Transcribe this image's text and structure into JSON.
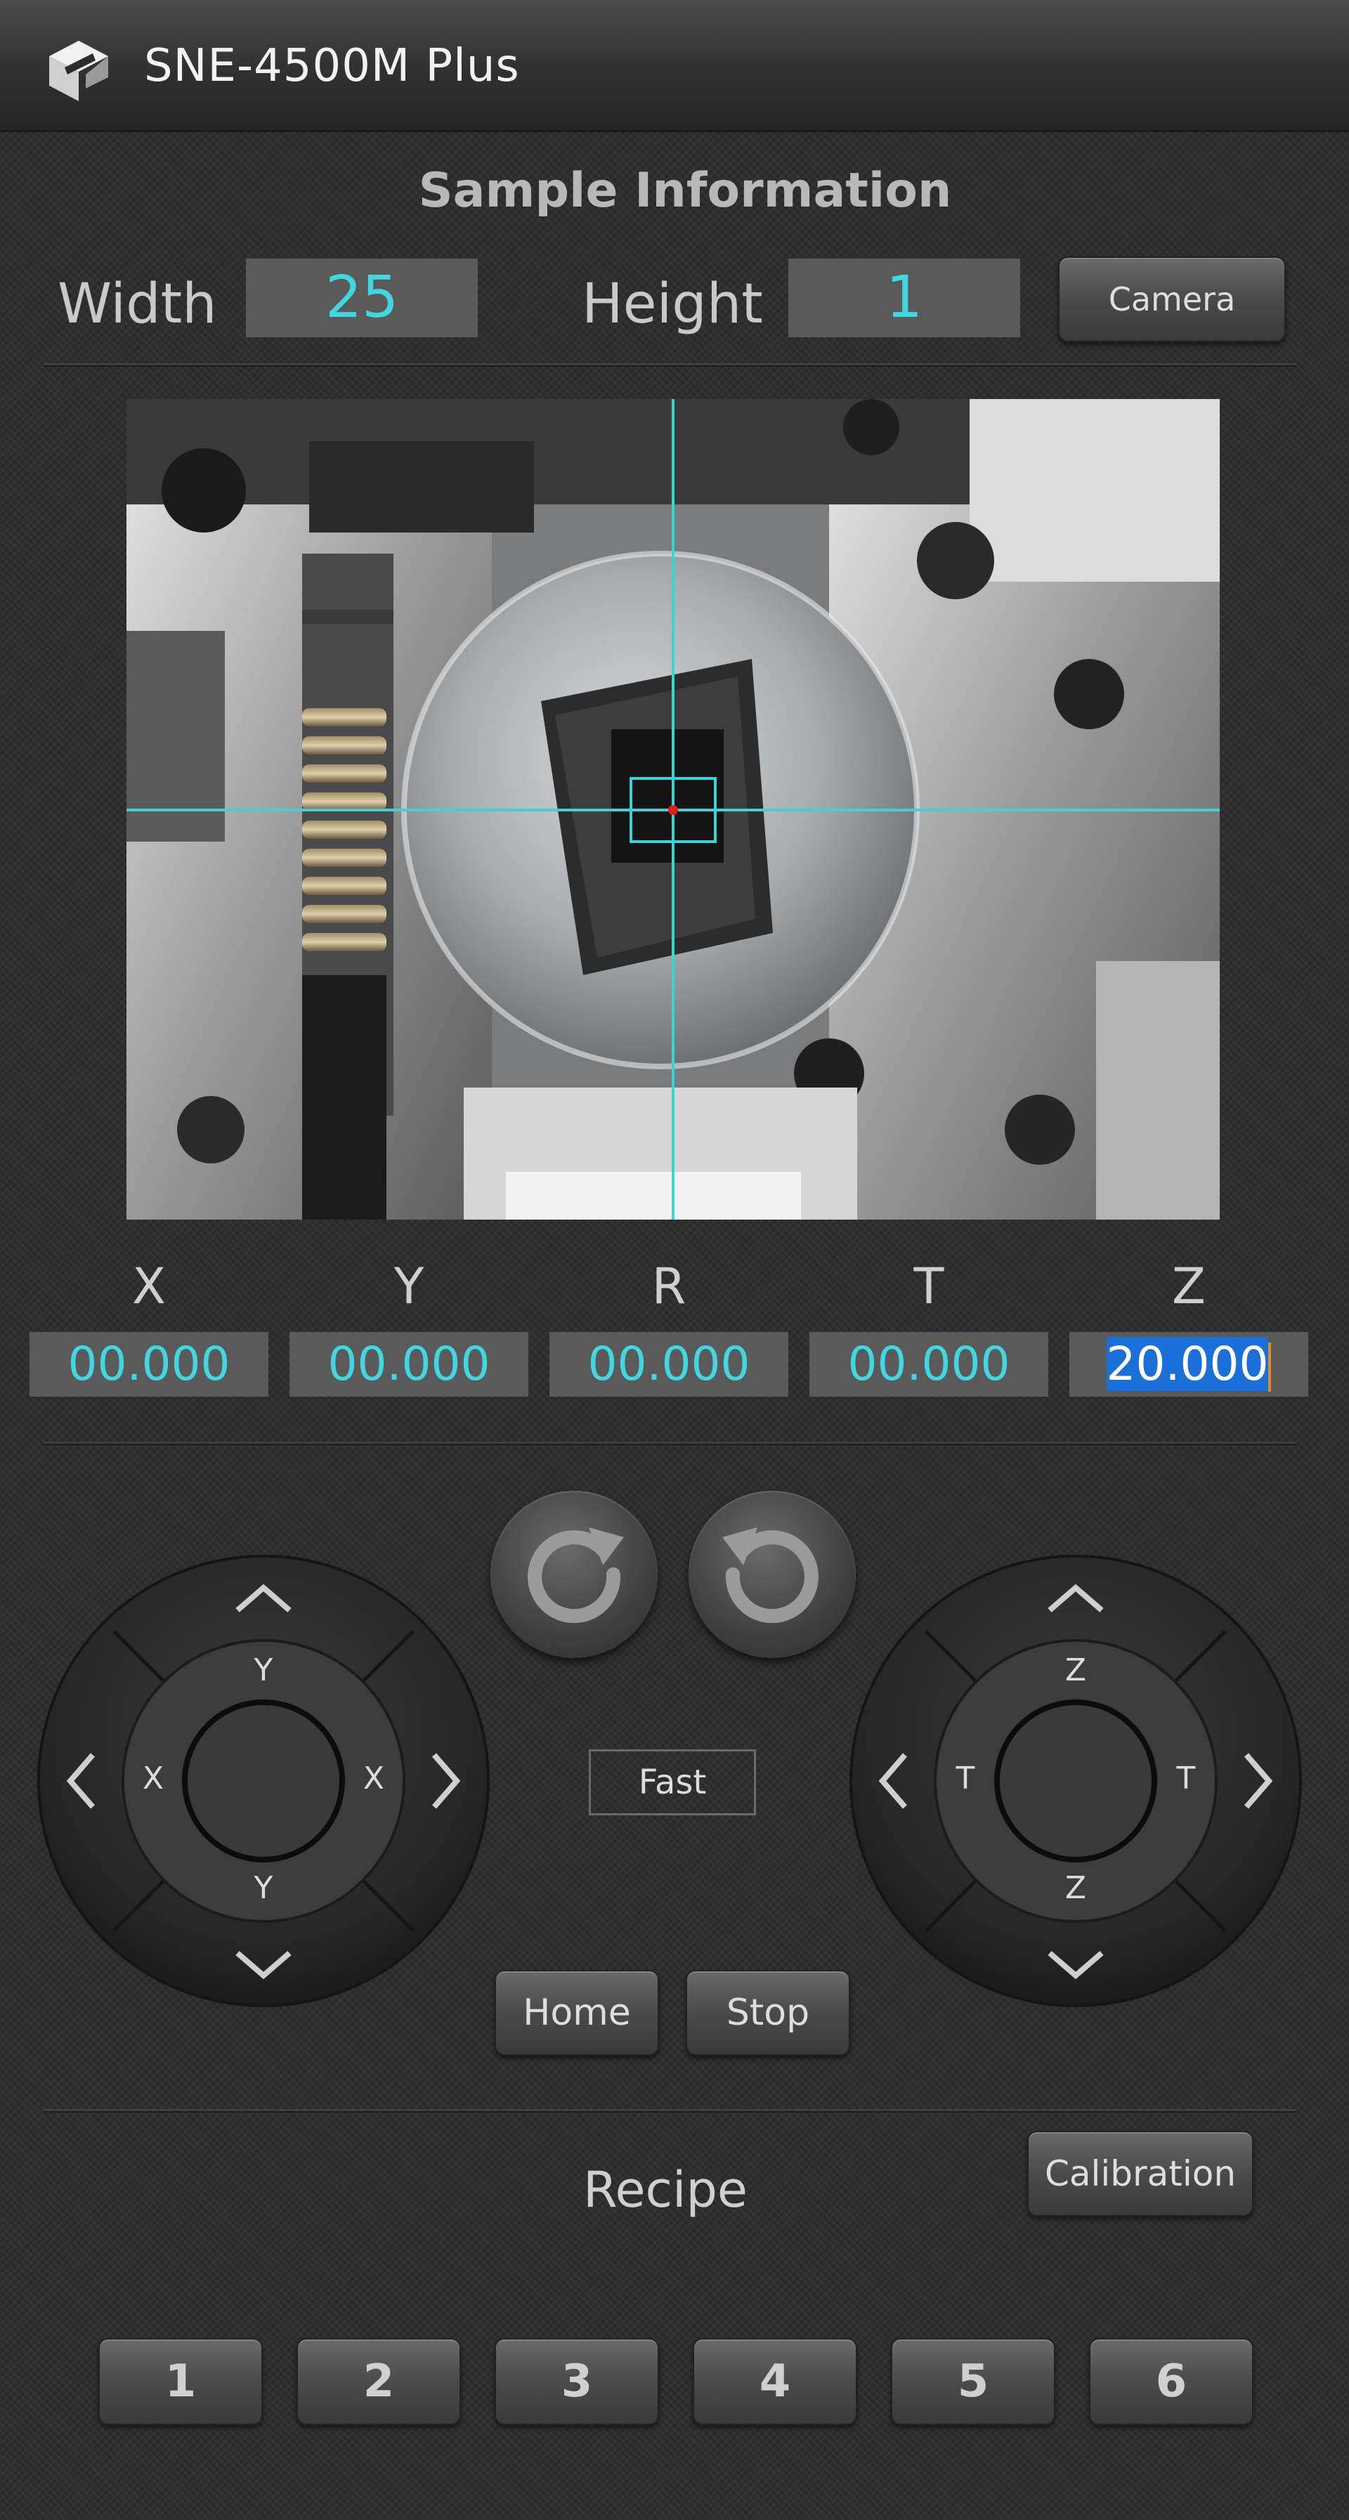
{
  "app": {
    "title": "SNE-4500M Plus",
    "logo_icon": "cube-logo-icon"
  },
  "sample_info": {
    "heading": "Sample Information",
    "width_label": "Width",
    "width_value": "25",
    "height_label": "Height",
    "height_value": "1",
    "camera_button": "Camera"
  },
  "camera_view": {
    "crosshair_color": "#3fd0d8",
    "center_marker_color": "#e02020"
  },
  "axes": [
    {
      "label": "X",
      "value": "00.000"
    },
    {
      "label": "Y",
      "value": "00.000"
    },
    {
      "label": "R",
      "value": "00.000"
    },
    {
      "label": "T",
      "value": "00.000"
    },
    {
      "label": "Z",
      "value": "20.000"
    }
  ],
  "controls": {
    "rotate_cw_icon": "rotate-clockwise-icon",
    "rotate_ccw_icon": "rotate-counterclockwise-icon",
    "left_pad": {
      "top": "Y",
      "bottom": "Y",
      "left": "X",
      "right": "X"
    },
    "right_pad": {
      "top": "Z",
      "bottom": "Z",
      "left": "T",
      "right": "T"
    },
    "speed_label": "Fast",
    "home_button": "Home",
    "stop_button": "Stop"
  },
  "recipe": {
    "label": "Recipe",
    "calibration_button": "Calibration",
    "buttons": [
      "1",
      "2",
      "3",
      "4",
      "5",
      "6"
    ]
  },
  "colors": {
    "value_text": "#41d6e0",
    "selection": "#1a6fd8",
    "background": "#2b2b2b"
  }
}
